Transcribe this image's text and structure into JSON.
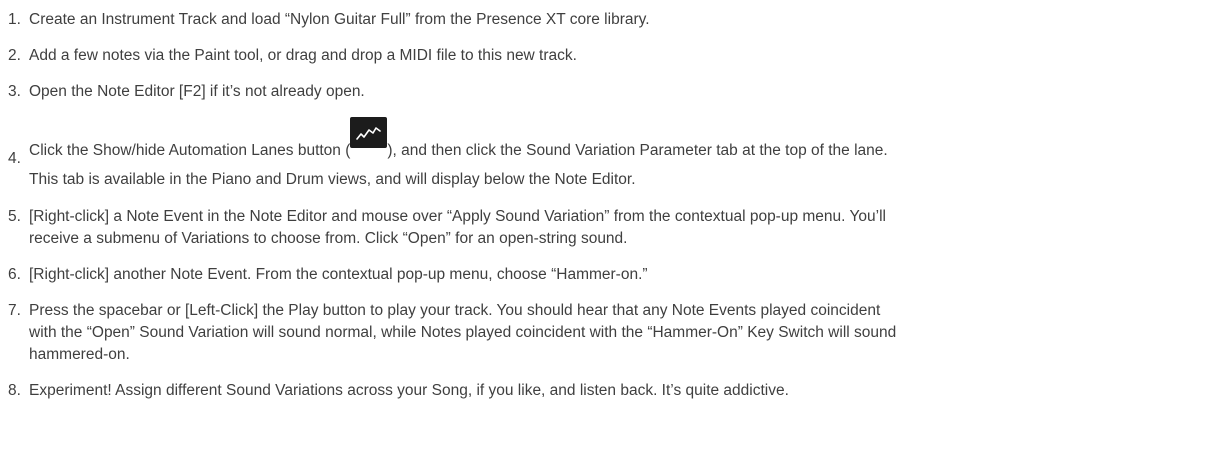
{
  "steps": [
    {
      "num": "1.",
      "text": "Create an Instrument Track and load “Nylon Guitar Full” from the Presence XT core library."
    },
    {
      "num": "2.",
      "text": "Add a few notes via the Paint tool, or drag and drop a MIDI file to this new track."
    },
    {
      "num": "3.",
      "text": "Open the Note Editor [F2] if it’s not already open."
    },
    {
      "num": "4.",
      "text_before": "Click the Show/hide Automation Lanes button (",
      "text_after": "), and then click the Sound Variation Parameter tab at the top of the lane.",
      "text_line2": "This tab is available in the Piano and Drum views, and will display below the Note Editor.",
      "icon": "automation-lanes-icon"
    },
    {
      "num": "5.",
      "line1": "[Right-click] a Note Event in the Note Editor and mouse over “Apply Sound Variation” from the contextual pop-up menu. You’ll",
      "line2": "receive a submenu of Variations to choose from. Click “Open” for an open-string sound."
    },
    {
      "num": "6.",
      "text": "[Right-click] another Note Event. From the contextual pop-up menu, choose “Hammer-on.”"
    },
    {
      "num": "7.",
      "line1": "Press the spacebar or [Left-Click] the Play button to play your track. You should hear that any Note Events played coincident",
      "line2": "with the “Open” Sound Variation will sound normal, while Notes played coincident with the “Hammer-On” Key Switch will sound",
      "line3": "hammered-on."
    },
    {
      "num": "8.",
      "text": "Experiment! Assign different Sound Variations across your Song, if you like, and listen back. It’s quite addictive."
    }
  ]
}
